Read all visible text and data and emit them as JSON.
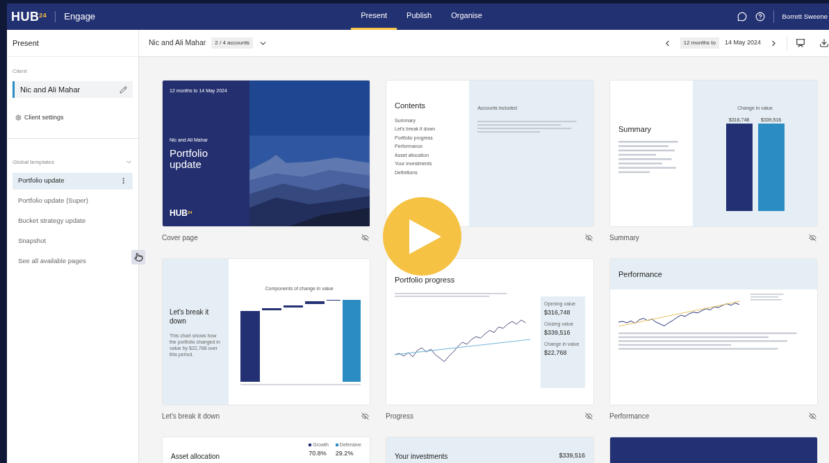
{
  "header": {
    "logo": "HUB",
    "logo_sup": "24",
    "app": "Engage",
    "tabs": [
      {
        "label": "Present",
        "selected": true
      },
      {
        "label": "Publish",
        "selected": false
      },
      {
        "label": "Organise",
        "selected": false
      }
    ],
    "user": "Borrett Sweene"
  },
  "sidebar": {
    "title": "Present",
    "client_label": "Client",
    "client": "Nic and Ali Mahar",
    "client_settings": "Client settings",
    "templates_label": "Global templates",
    "templates": [
      {
        "label": "Portfolio update",
        "selected": true
      },
      {
        "label": "Portfolio update (Super)",
        "selected": false
      },
      {
        "label": "Bucket strategy update",
        "selected": false
      },
      {
        "label": "Snapshot",
        "selected": false
      }
    ],
    "see_all": "See all available pages"
  },
  "toolbar": {
    "client": "Nic and Ali Mahar",
    "accounts": "2 / 4 accounts",
    "period": "12 months to",
    "date": "14 May 2024"
  },
  "pages": [
    {
      "kind": "cover",
      "caption": "Cover page",
      "visibility_icon": true,
      "date": "12 months to 14 May 2024",
      "client": "Nic and Ali Mahar",
      "title": "Portfolio update",
      "logo": "HUB",
      "logo_sup": "24"
    },
    {
      "kind": "contents",
      "visibility_icon": true,
      "title": "Contents",
      "items": [
        "Summary",
        "Let's break it down",
        "Portfolio progress",
        "Performance",
        "Asset allocation",
        "Your investments",
        "Definitions"
      ],
      "accounts_label": "Accounts included"
    },
    {
      "kind": "summary",
      "caption": "Summary",
      "visibility_icon": true,
      "title": "Summary",
      "chart_title": "Change in value",
      "bars": [
        {
          "value": "$316,748",
          "color": "#233174"
        },
        {
          "value": "$339,516",
          "color": "#2b8cc4"
        }
      ]
    },
    {
      "kind": "breakdown",
      "caption": "Let's break it down",
      "visibility_icon": true,
      "title": "Let's break it down",
      "body": "This chart shows how the portfolio changed in value by $22,768 over this period.",
      "chart_title": "Components of change in value"
    },
    {
      "kind": "progress",
      "caption": "Progress",
      "visibility_icon": true,
      "title": "Portfolio progress",
      "stats": [
        {
          "label": "Opening value",
          "value": "$316,748"
        },
        {
          "label": "Closing value",
          "value": "$339,516"
        },
        {
          "label": "Change in value",
          "value": "$22,768"
        }
      ]
    },
    {
      "kind": "performance",
      "caption": "Performance",
      "visibility_icon": true,
      "title": "Performance"
    },
    {
      "kind": "allocation",
      "title": "Asset allocation",
      "legend": [
        {
          "label": "Growth",
          "value": "70.8%",
          "color": "#233174"
        },
        {
          "label": "Defensive",
          "value": "29.2%",
          "color": "#2b8cc4"
        }
      ]
    },
    {
      "kind": "investments",
      "title": "Your investments",
      "value": "$339,516"
    },
    {
      "kind": "blank"
    }
  ]
}
